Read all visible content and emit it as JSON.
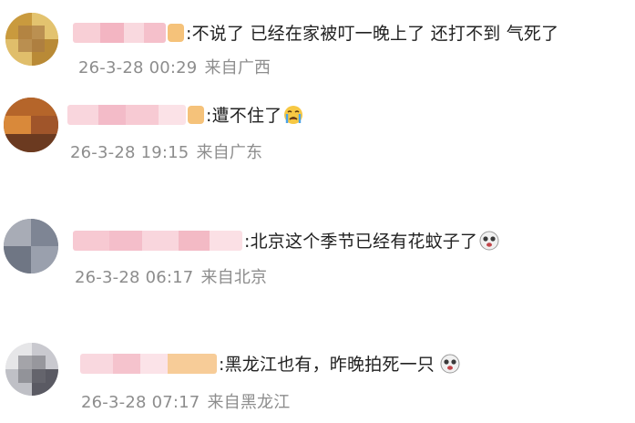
{
  "comments": [
    {
      "text": ":不说了 已经在家被叮一晚上了 还打不到 气死了",
      "time": "26-3-28 00:29",
      "location": "来自广西",
      "emoji": ""
    },
    {
      "text": ":遭不住了",
      "time": "26-3-28 19:15",
      "location": "来自广东",
      "emoji": "crying-face-icon"
    },
    {
      "text": ":北京这个季节已经有花蚊子了",
      "time": "26-3-28 06:17",
      "location": "来自北京",
      "emoji": "dizzy-face-icon"
    },
    {
      "text": ":黑龙江也有，昨晚拍死一只",
      "time": "26-3-28 07:17",
      "location": "来自黑龙江",
      "emoji": "dizzy-face-icon"
    }
  ],
  "colors": {
    "text": "#222222",
    "meta": "#8d8d8d",
    "blur_pink": "#f4b6c2",
    "badge": "#f5c27a"
  }
}
